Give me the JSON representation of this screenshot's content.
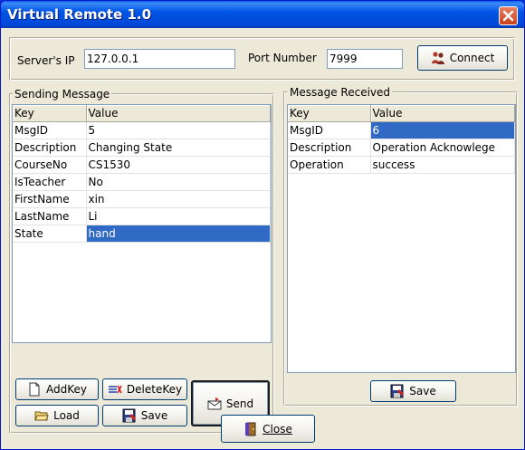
{
  "window": {
    "title": "Virtual Remote 1.0"
  },
  "connection": {
    "server_ip_label": "Server's IP",
    "server_ip_value": "127.0.0.1",
    "port_label": "Port Number",
    "port_value": "7999",
    "connect_label": "Connect"
  },
  "sending": {
    "title": "Sending Message",
    "columns": [
      "Key",
      "Value"
    ],
    "rows": [
      {
        "key": "MsgID",
        "value": "5"
      },
      {
        "key": "Description",
        "value": "Changing State"
      },
      {
        "key": "CourseNo",
        "value": "CS1530"
      },
      {
        "key": "IsTeacher",
        "value": "No"
      },
      {
        "key": "FirstName",
        "value": "xin"
      },
      {
        "key": "LastName",
        "value": "Li"
      },
      {
        "key": "State",
        "value": "hand"
      }
    ],
    "selected_row": 6,
    "buttons": {
      "add_key": "AddKey",
      "delete_key": "DeleteKey",
      "send": "Send",
      "load": "Load",
      "save": "Save"
    }
  },
  "received": {
    "title": "Message Received",
    "columns": [
      "Key",
      "Value"
    ],
    "rows": [
      {
        "key": "MsgID",
        "value": "6"
      },
      {
        "key": "Description",
        "value": "Operation Acknowlege"
      },
      {
        "key": "Operation",
        "value": "success"
      }
    ],
    "selected_row": 0,
    "save_label": "Save"
  },
  "footer": {
    "close_label": "Close"
  },
  "colors": {
    "titlebar": "#0055e5",
    "selection": "#316ac5",
    "face": "#ece9d8",
    "close_button": "#c9401b"
  },
  "icons": {
    "connect": "people-icon",
    "add_key": "new-document-icon",
    "delete_key": "delete-list-icon",
    "send": "envelope-send-icon",
    "load": "open-folder-icon",
    "save": "save-disk-icon",
    "close": "exit-door-icon",
    "window_close": "close-icon"
  }
}
